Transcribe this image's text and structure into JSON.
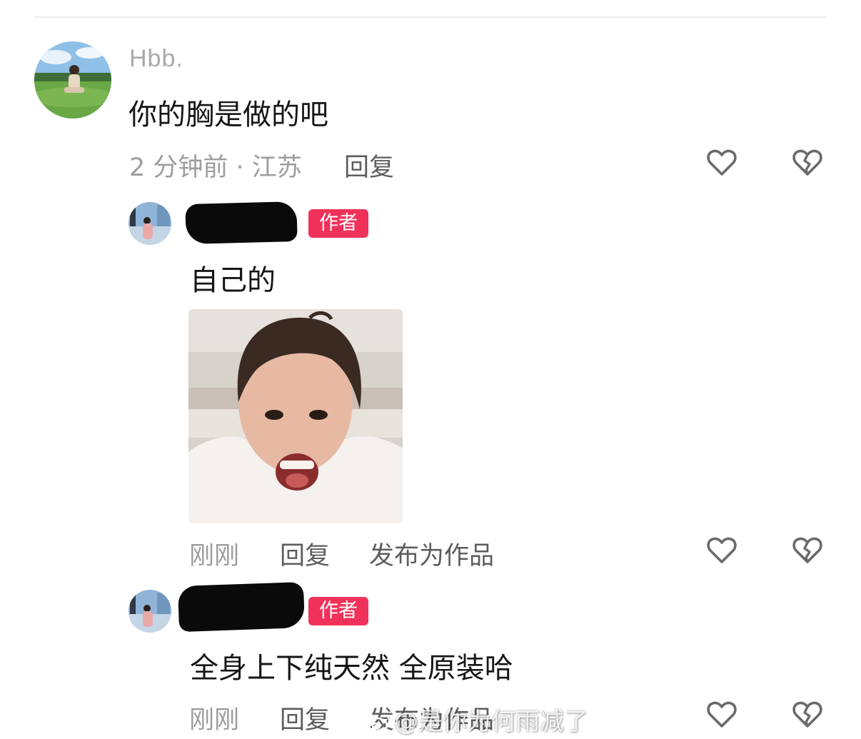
{
  "comment": {
    "username": "Hbb.",
    "text": "你的胸是做的吧",
    "meta": "2 分钟前 · 江苏",
    "reply_label": "回复",
    "like_icon": "heart-outline-icon",
    "dislike_icon": "broken-heart-icon"
  },
  "replies": [
    {
      "badge": "作者",
      "text": "自己的",
      "has_image": true,
      "time": "刚刚",
      "reply_label": "回复",
      "publish_label": "发布为作品"
    },
    {
      "badge": "作者",
      "text": "全身上下纯天然 全原装哈",
      "time": "刚刚",
      "reply_label": "回复",
      "publish_label": "发布为作品"
    }
  ],
  "watermark": {
    "text": "@是你为何雨减了",
    "icon": "weibo-icon"
  },
  "colors": {
    "badge": "#f0325a",
    "meta": "#9d9d9d",
    "action": "#5d5d5d",
    "text": "#161616"
  }
}
